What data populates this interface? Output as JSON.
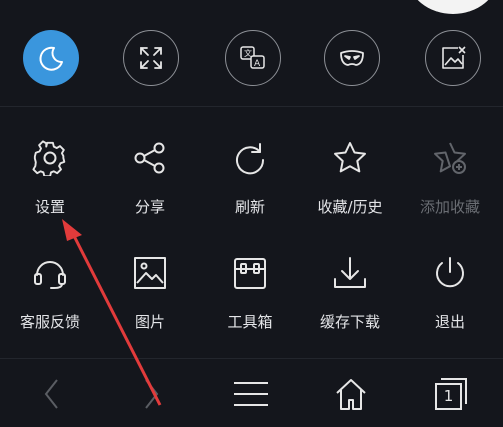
{
  "top_toggles": [
    {
      "icon": "moon-icon",
      "active": true
    },
    {
      "icon": "fullscreen-icon",
      "active": false
    },
    {
      "icon": "translate-icon",
      "active": false
    },
    {
      "icon": "mask-icon",
      "active": false
    },
    {
      "icon": "no-image-icon",
      "active": false
    }
  ],
  "menu": {
    "settings": {
      "label": "设置",
      "icon": "gear-icon"
    },
    "share": {
      "label": "分享",
      "icon": "share-icon"
    },
    "refresh": {
      "label": "刷新",
      "icon": "refresh-icon"
    },
    "favorites_history": {
      "label": "收藏/历史",
      "icon": "star-icon"
    },
    "add_favorite": {
      "label": "添加收藏",
      "icon": "star-plus-icon",
      "disabled": true
    },
    "support": {
      "label": "客服反馈",
      "icon": "headset-icon"
    },
    "images": {
      "label": "图片",
      "icon": "image-icon"
    },
    "toolbox": {
      "label": "工具箱",
      "icon": "toolbox-icon"
    },
    "download": {
      "label": "缓存下载",
      "icon": "download-icon"
    },
    "exit": {
      "label": "退出",
      "icon": "power-icon"
    }
  },
  "bottom_bar": {
    "tab_count": "1",
    "icons": [
      "back-icon",
      "forward-icon",
      "menu-icon",
      "home-icon",
      "tabs-icon"
    ]
  },
  "colors": {
    "background": "#14161c",
    "accent": "#3a96dd",
    "annotation": "#e23b3b"
  }
}
